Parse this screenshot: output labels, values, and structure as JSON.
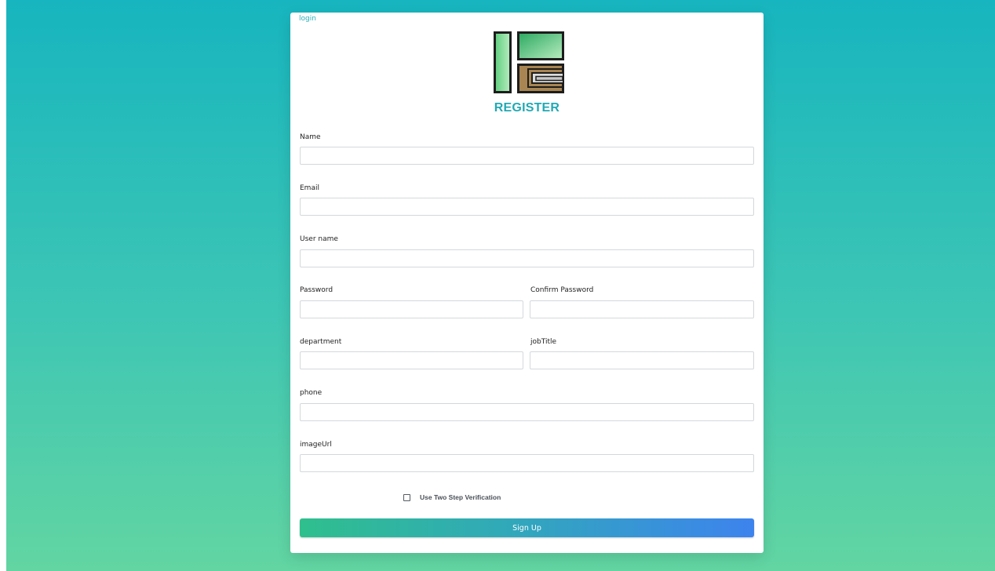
{
  "header": {
    "login_link": "login",
    "title": "REGISTER"
  },
  "logo": {
    "icon": "register-logo-icon",
    "colors": {
      "green_dark": "#2aa860",
      "green_light": "#9ae3a8",
      "brown": "#a88552",
      "outline": "#1d1d1d"
    }
  },
  "form": {
    "name_label": "Name",
    "email_label": "Email",
    "username_label": "User name",
    "password_label": "Password",
    "confirm_password_label": "Confirm Password",
    "department_label": "department",
    "jobtitle_label": "jobTitle",
    "phone_label": "phone",
    "imageurl_label": "imageUrl",
    "values": {
      "name": "",
      "email": "",
      "username": "",
      "password": "",
      "confirm_password": "",
      "department": "",
      "jobtitle": "",
      "phone": "",
      "imageurl": ""
    },
    "two_step_label": "Use Two Step Verification",
    "two_step_checked": false,
    "submit_label": "Sign Up"
  },
  "colors": {
    "accent": "#21a9b3",
    "background_top": "#17b5bf",
    "background_bottom": "#62d5a2",
    "button_start": "#2fbf8d",
    "button_end": "#3d83ee"
  }
}
